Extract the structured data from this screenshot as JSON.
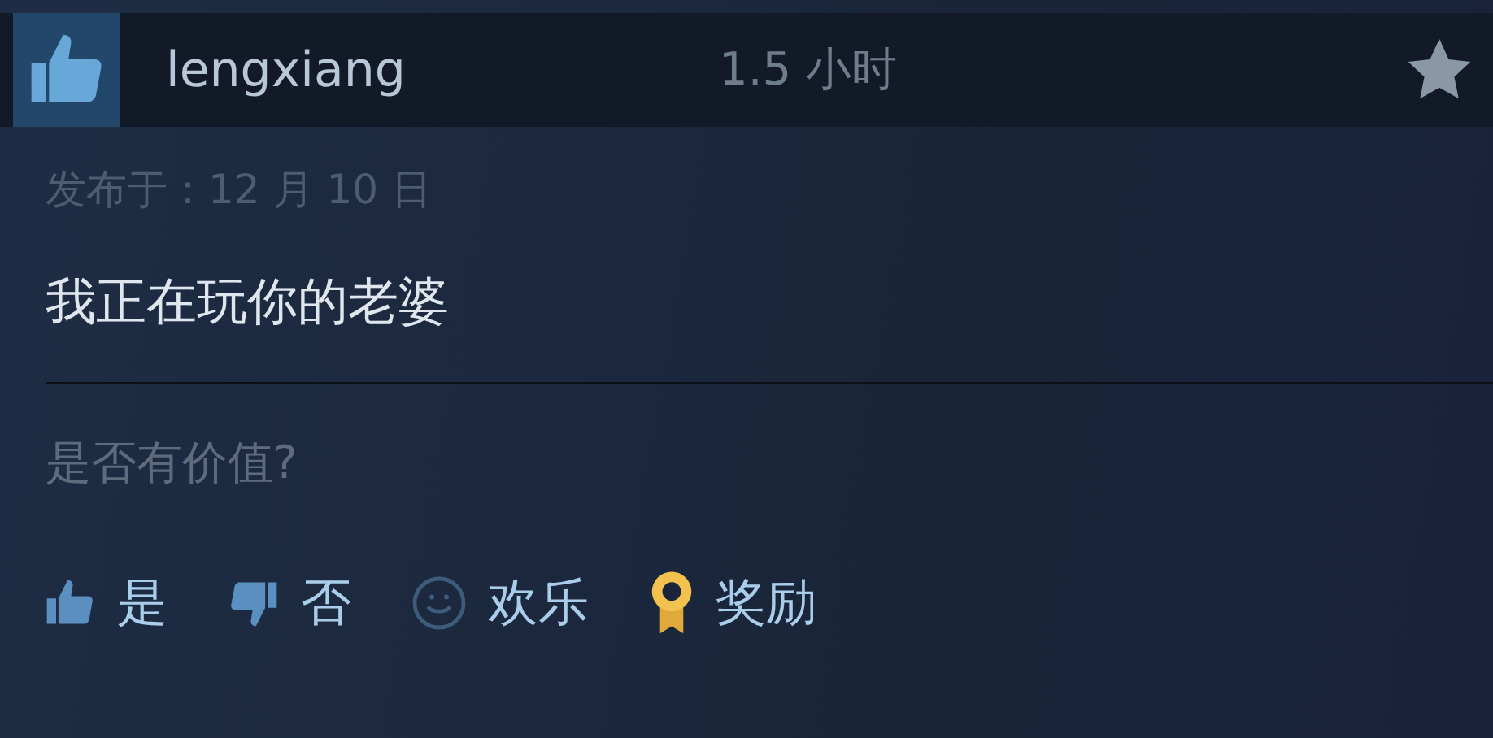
{
  "review": {
    "recommended": true,
    "username": "lengxiang",
    "playtime": "1.5 小时",
    "date": "发布于：12 月 10 日",
    "text": "我正在玩你的老婆"
  },
  "helpful": {
    "question": "是否有价值?",
    "actions": [
      {
        "kind": "yes",
        "label": "是"
      },
      {
        "kind": "no",
        "label": "否"
      },
      {
        "kind": "funny",
        "label": "欢乐"
      },
      {
        "kind": "award",
        "label": "奖励"
      }
    ]
  }
}
